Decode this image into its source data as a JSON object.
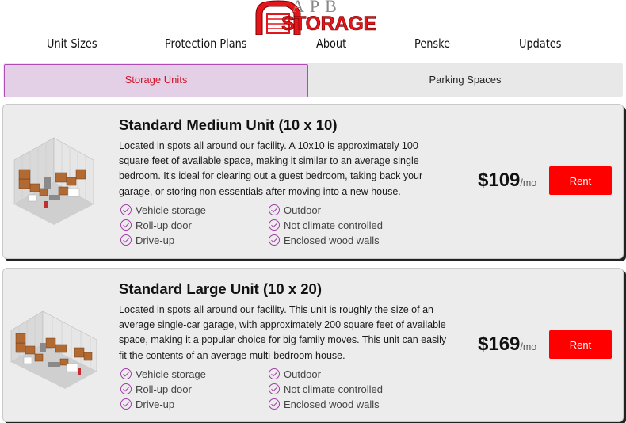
{
  "header": {
    "logo_top": "APB",
    "logo_bottom": "STORAGE"
  },
  "nav": {
    "items": [
      "Unit Sizes",
      "Protection Plans",
      "About",
      "Penske",
      "Updates"
    ]
  },
  "tabs": {
    "active": "Storage Units",
    "inactive": "Parking Spaces"
  },
  "units": [
    {
      "title": "Standard Medium Unit (10 x 10)",
      "description": "Located in spots all around our facility. A 10x10 is approximately 100 square feet of available space, making it similar to an average single bedroom. It's ideal for clearing out a guest bedroom, taking back your garage, or storing non-essentials after moving into a new house.",
      "features_left": [
        "Vehicle storage",
        "Roll-up door",
        "Drive-up"
      ],
      "features_right": [
        "Outdoor",
        "Not climate controlled",
        "Enclosed wood walls"
      ],
      "price": "$109",
      "per": "/mo",
      "button": "Rent"
    },
    {
      "title": "Standard Large Unit (10 x 20)",
      "description": "Located in spots all around our facility. This unit is roughly the size of an average single-car garage, with approximately 200 square feet of available space, making it a popular choice for big family moves. This unit can easily fit the contents of an average multi-bedroom house.",
      "features_left": [
        "Vehicle storage",
        "Roll-up door",
        "Drive-up"
      ],
      "features_right": [
        "Outdoor",
        "Not climate controlled",
        "Enclosed wood walls"
      ],
      "price": "$169",
      "per": "/mo",
      "button": "Rent"
    }
  ],
  "colors": {
    "accent": "#a23fa8",
    "rent_button": "#ff0000",
    "active_tab_bg": "#e4d0e6",
    "active_tab_text": "#d0142a"
  }
}
